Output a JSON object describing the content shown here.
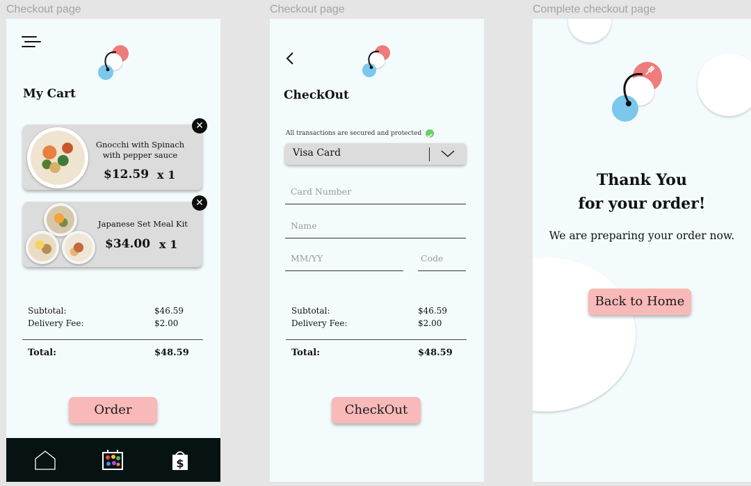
{
  "screens": {
    "cart": {
      "label": "Checkout page",
      "title": "My Cart",
      "items": [
        {
          "name_line1": "Gnocchi with Spinach",
          "name_line2": "with pepper sauce",
          "price": "$12.59",
          "qty": "x 1"
        },
        {
          "name_line1": "Japanese Set Meal Kit",
          "name_line2": "",
          "price": "$34.00",
          "qty": "x 1"
        }
      ],
      "summary": {
        "subtotal_label": "Subtotal:",
        "subtotal_value": "$46.59",
        "delivery_label": "Delivery Fee:",
        "delivery_value": "$2.00",
        "total_label": "Total:",
        "total_value": "$48.59"
      },
      "order_button": "Order",
      "close_glyph": "✕",
      "nav": [
        "home-icon",
        "menu-palette-icon",
        "wallet-icon"
      ]
    },
    "checkout": {
      "label": "Checkout page",
      "title": "CheckOut",
      "secure_note": "All transactions are secured and protected",
      "card_type": "Visa Card",
      "fields": {
        "card_number": "Card Number",
        "name": "Name",
        "expiry": "MM/YY",
        "code": "Code"
      },
      "summary": {
        "subtotal_label": "Subtotal:",
        "subtotal_value": "$46.59",
        "delivery_label": "Delivery Fee:",
        "delivery_value": "$2.00",
        "total_label": "Total:",
        "total_value": "$48.59"
      },
      "checkout_button": "CheckOut"
    },
    "complete": {
      "label": "Complete checkout page",
      "thanks_line1": "Thank You",
      "thanks_line2": "for your order!",
      "preparing": "We are preparing your order now.",
      "home_button": "Back to Home"
    }
  },
  "colors": {
    "frame_bg": "#f4fbfc",
    "button": "#f9b9b9",
    "logo_red": "#f07b7b",
    "logo_blue": "#7cc8ec",
    "nav_bg": "#071312",
    "card_bg": "#dcdcdc"
  }
}
